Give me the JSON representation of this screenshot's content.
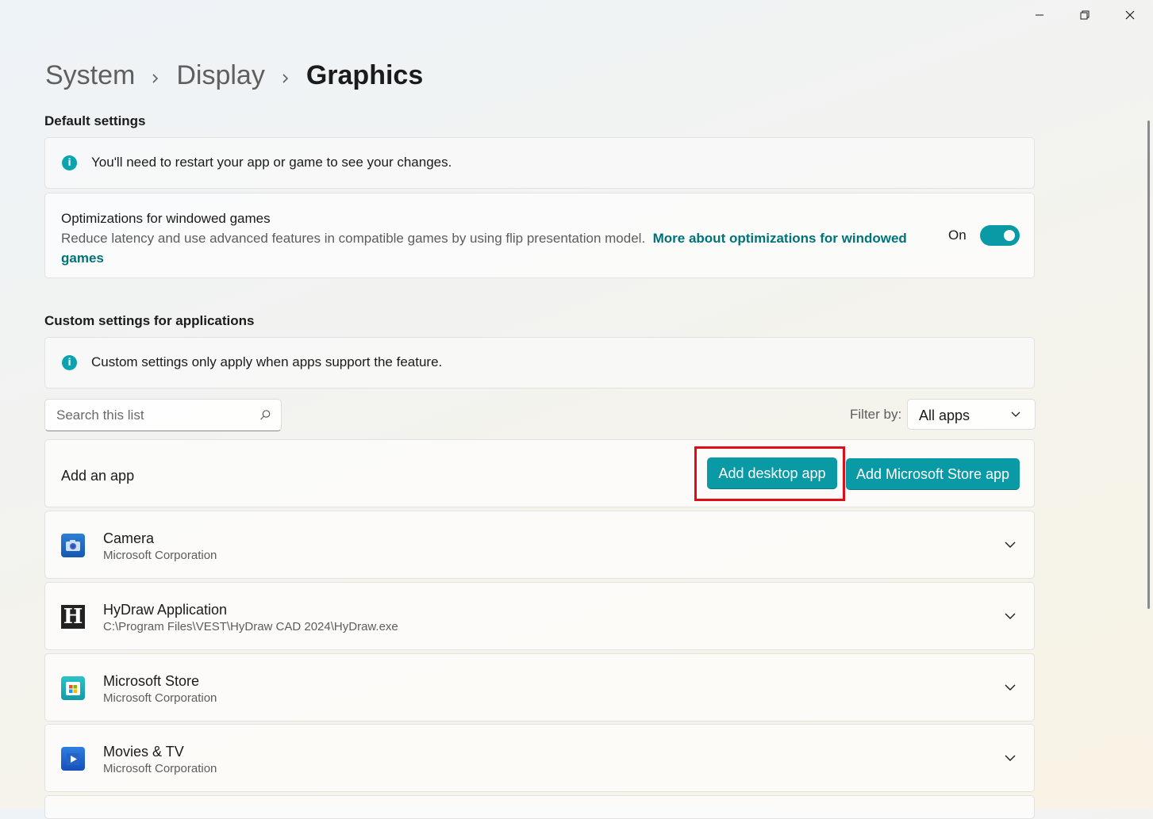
{
  "window": {
    "minimize_icon": "minimize-icon",
    "restore_icon": "restore-icon",
    "close_icon": "close-icon"
  },
  "breadcrumb": {
    "items": [
      "System",
      "Display",
      "Graphics"
    ],
    "separator": "›"
  },
  "default_settings": {
    "title": "Default settings",
    "info_icon": "i",
    "info_text": "You'll need to restart your app or game to see your changes.",
    "optimizations": {
      "title": "Optimizations for windowed games",
      "description": "Reduce latency and use advanced features in compatible games by using flip presentation model.",
      "link": "More about optimizations for windowed games",
      "toggle_label": "On",
      "toggle_on": true
    }
  },
  "custom_settings": {
    "title": "Custom settings for applications",
    "info_icon": "i",
    "info_text": "Custom settings only apply when apps support the feature.",
    "search": {
      "placeholder": "Search this list",
      "value": ""
    },
    "filter": {
      "label": "Filter by:",
      "value": "All apps"
    },
    "add_app": {
      "label": "Add an app",
      "desktop_button": "Add desktop app",
      "store_button": "Add Microsoft Store app"
    },
    "apps": [
      {
        "name": "Camera",
        "publisher": "Microsoft Corporation",
        "icon": "camera-icon"
      },
      {
        "name": "HyDraw Application",
        "publisher": "C:\\Program Files\\VEST\\HyDraw CAD 2024\\HyDraw.exe",
        "icon": "hydraw-icon",
        "icon_letter": "H"
      },
      {
        "name": "Microsoft Store",
        "publisher": "Microsoft Corporation",
        "icon": "microsoft-store-icon"
      },
      {
        "name": "Movies & TV",
        "publisher": "Microsoft Corporation",
        "icon": "movies-tv-icon"
      }
    ]
  },
  "colors": {
    "accent": "#0a9aa5",
    "link": "#00727a",
    "highlight": "#e00d18"
  }
}
